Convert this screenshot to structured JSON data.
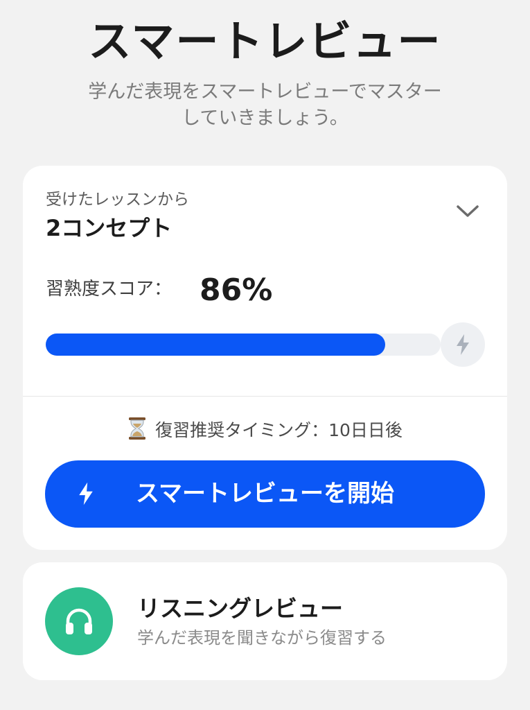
{
  "header": {
    "title": "スマートレビュー",
    "subtitle": "学んだ表現をスマートレビューでマスターしていきましょう。"
  },
  "review_card": {
    "lessons_caption": "受けたレッスンから",
    "concept_count": "2コンセプト",
    "expand_icon": "chevron-down-icon",
    "mastery_label": "習熟度スコア：",
    "mastery_value": "86%",
    "mastery_progress": 0.86,
    "progress_end_icon": "bolt-icon",
    "timing_icon": "hourglass-icon",
    "timing_text": "復習推奨タイミング：10日日後",
    "start_button": {
      "icon": "bolt-icon",
      "label": "スマートレビューを開始"
    }
  },
  "listening_card": {
    "icon": "headphones-icon",
    "title": "リスニングレビュー",
    "subtitle": "学んだ表現を聞きながら復習する"
  },
  "colors": {
    "accent_blue": "#0b57f6",
    "listening_green": "#2ebf8f",
    "background": "#f2f2f2",
    "card": "#ffffff",
    "track": "#eef0f3"
  }
}
